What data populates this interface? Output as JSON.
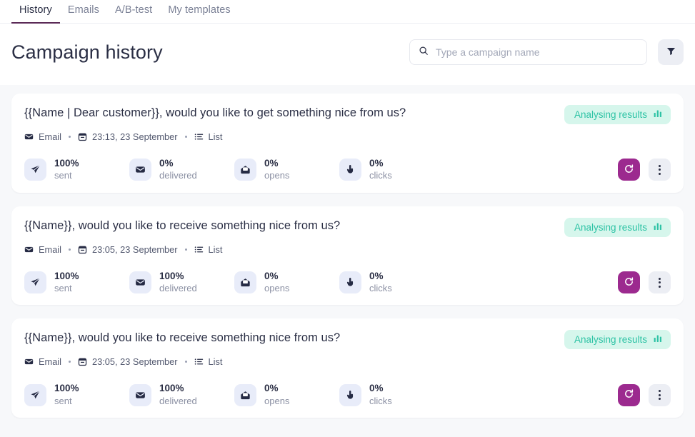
{
  "tabs": [
    {
      "label": "History",
      "active": true
    },
    {
      "label": "Emails",
      "active": false
    },
    {
      "label": "A/B-test",
      "active": false
    },
    {
      "label": "My templates",
      "active": false
    }
  ],
  "header": {
    "title": "Campaign history",
    "search_placeholder": "Type a campaign name",
    "search_value": "",
    "search_icon": "search-icon",
    "filter_icon": "funnel-icon"
  },
  "colors": {
    "page_bg": "#f7f8fa",
    "card_bg": "#ffffff",
    "accent_purple": "#9c2a8f",
    "tab_underline": "#5b2a57",
    "badge_bg": "#d6f6ec",
    "badge_text": "#2ec3a5",
    "stat_icon_bg": "#e8ecf9",
    "text_primary": "#2b2f45",
    "text_muted": "#8b90a3"
  },
  "stat_labels": {
    "sent": "sent",
    "delivered": "delivered",
    "opens": "opens",
    "clicks": "clicks"
  },
  "campaigns": [
    {
      "title": "{{Name | Dear customer}}, would you like to get something nice from us?",
      "status": "Analysing results",
      "channel": "Email",
      "datetime": "23:13, 23 September",
      "audience": "List",
      "stats": {
        "sent": "100%",
        "delivered": "0%",
        "opens": "0%",
        "clicks": "0%"
      }
    },
    {
      "title": "{{Name}}, would you like to receive something nice from us?",
      "status": "Analysing results",
      "channel": "Email",
      "datetime": "23:05, 23 September",
      "audience": "List",
      "stats": {
        "sent": "100%",
        "delivered": "100%",
        "opens": "0%",
        "clicks": "0%"
      }
    },
    {
      "title": "{{Name}}, would you like to receive something nice from us?",
      "status": "Analysing results",
      "channel": "Email",
      "datetime": "23:05, 23 September",
      "audience": "List",
      "stats": {
        "sent": "100%",
        "delivered": "100%",
        "opens": "0%",
        "clicks": "0%"
      }
    }
  ]
}
